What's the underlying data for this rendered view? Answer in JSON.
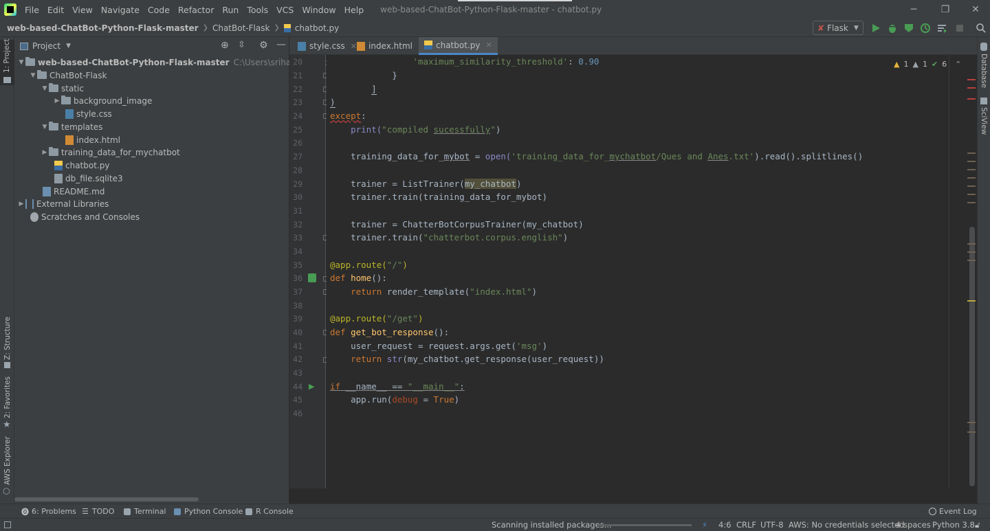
{
  "window": {
    "title": "web-based-ChatBot-Python-Flask-master - chatbot.py",
    "controls": {
      "minimize": "─",
      "maximize": "❐",
      "close": "✕"
    }
  },
  "menu": [
    "File",
    "Edit",
    "View",
    "Navigate",
    "Code",
    "Refactor",
    "Run",
    "Tools",
    "VCS",
    "Window",
    "Help"
  ],
  "breadcrumb": [
    "web-based-ChatBot-Python-Flask-master",
    "ChatBot-Flask",
    "chatbot.py"
  ],
  "toolbar": {
    "run_config": "Flask"
  },
  "left_tools": {
    "project": "1: Project",
    "structure": "Z: Structure",
    "favorites": "2: Favorites",
    "aws": "AWS Explorer"
  },
  "right_tools": {
    "database": "Database",
    "sciview": "SciView"
  },
  "project_panel": {
    "title": "Project",
    "tree": [
      {
        "label": "web-based-ChatBot-Python-Flask-master",
        "hint": "C:\\Users\\srihari\\Desktop\\we"
      },
      {
        "label": "ChatBot-Flask"
      },
      {
        "label": "static"
      },
      {
        "label": "background_image"
      },
      {
        "label": "style.css"
      },
      {
        "label": "templates"
      },
      {
        "label": "index.html"
      },
      {
        "label": "training_data_for_mychatbot"
      },
      {
        "label": "chatbot.py"
      },
      {
        "label": "db_file.sqlite3"
      },
      {
        "label": "README.md"
      },
      {
        "label": "External Libraries"
      },
      {
        "label": "Scratches and Consoles"
      }
    ]
  },
  "tabs": [
    {
      "label": "style.css"
    },
    {
      "label": "index.html"
    },
    {
      "label": "chatbot.py",
      "active": true
    }
  ],
  "inspections": {
    "warnings_a": "1",
    "warnings_b": "1",
    "ok": "6"
  },
  "line_numbers": [
    "20",
    "21",
    "22",
    "23",
    "24",
    "25",
    "26",
    "27",
    "28",
    "29",
    "30",
    "31",
    "32",
    "33",
    "34",
    "35",
    "36",
    "37",
    "38",
    "39",
    "40",
    "41",
    "42",
    "43",
    "44",
    "45",
    "46"
  ],
  "code": {
    "l20a": "'maximum_similarity_threshold'",
    "l20b": ": ",
    "l20c": "0.90",
    "l21": "}",
    "l22": "]",
    "l23": ")",
    "l24a": "except",
    "l24b": ":",
    "l25a": "print(",
    "l25b": "\"compiled ",
    "l25c": "sucessfully",
    "l25d": "\"",
    "l25e": ")",
    "l27a": "training_data_for_",
    "l27b": "mybot",
    "l27c": " = ",
    "l27d": "open(",
    "l27e": "'training_data_for_",
    "l27f": "mychatbot",
    "l27g": "/Ques and ",
    "l27h": "Anes",
    "l27i": ".txt'",
    "l27j": ").read().splitlines()",
    "l29a": "trainer = ListTrainer(",
    "l29b": "my_chatbot",
    "l29c": ")",
    "l30": "trainer.train(training_data_for_mybot)",
    "l32": "trainer = ChatterBotCorpusTrainer(my_chatbot)",
    "l33a": "trainer.train(",
    "l33b": "\"chatterbot.corpus.english\"",
    "l33c": ")",
    "l35a": "@app.route(",
    "l35b": "\"/\"",
    "l35c": ")",
    "l36a": "def ",
    "l36b": "home",
    "l36c": "():",
    "l37a": "return ",
    "l37b": "render_template(",
    "l37c": "\"index.html\"",
    "l37d": ")",
    "l39a": "@app.route(",
    "l39b": "\"/get\"",
    "l39c": ")",
    "l40a": "def ",
    "l40b": "get_bot_response",
    "l40c": "():",
    "l41a": "user_request = request.args.get(",
    "l41b": "'msg'",
    "l41c": ")",
    "l42a": "return ",
    "l42b": "str",
    "l42c": "(my_chatbot.get_response(user_request))",
    "l44a": "if",
    "l44b": " __name__ == ",
    "l44c": "\"__main__\"",
    "l44d": ":",
    "l45a": "app.run(",
    "l45b": "debug",
    "l45c": " = ",
    "l45d": "True",
    "l45e": ")"
  },
  "bottom_tools": [
    "6: Problems",
    "TODO",
    "Terminal",
    "Python Console",
    "R Console",
    "Event Log"
  ],
  "status": {
    "message": "Scanning installed packages...",
    "position": "4:6",
    "line_sep": "CRLF",
    "encoding": "UTF-8",
    "aws": "AWS: No credentials selected",
    "indent": "4 spaces",
    "interpreter": "Python 3.8"
  },
  "colors": {
    "accent": "#4a88c7",
    "keyword": "#cc7832",
    "string": "#6a8759",
    "number": "#6897bb",
    "function": "#ffc66d",
    "decorator": "#bbb529"
  }
}
